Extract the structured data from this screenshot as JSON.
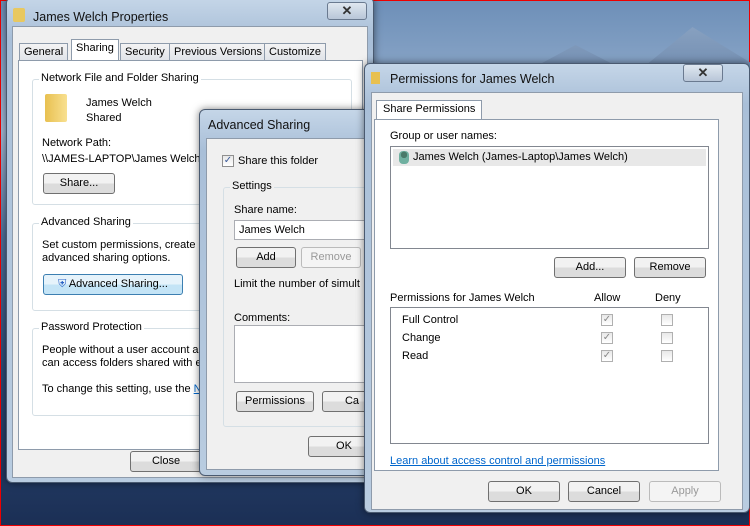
{
  "properties": {
    "title": "James Welch Properties",
    "tabs": [
      "General",
      "Sharing",
      "Security",
      "Previous Versions",
      "Customize"
    ],
    "network_group": "Network File and Folder Sharing",
    "folder_name": "James Welch",
    "folder_status": "Shared",
    "network_path_label": "Network Path:",
    "network_path": "\\\\JAMES-LAPTOP\\James Welch",
    "share_button": "Share...",
    "advanced_group": "Advanced Sharing",
    "advanced_text1": "Set custom permissions, create mu",
    "advanced_text2": "advanced sharing options.",
    "advanced_button": "Advanced Sharing...",
    "password_group": "Password Protection",
    "password_text1": "People without a user account an",
    "password_text2": "can access folders shared with ev",
    "password_text3": "To change this setting, use the ",
    "password_link": "Ne",
    "close_button": "Close"
  },
  "advanced": {
    "title": "Advanced Sharing",
    "share_checkbox": "Share this folder",
    "share_checked": true,
    "settings_group": "Settings",
    "share_name_label": "Share name:",
    "share_name_value": "James Welch",
    "add_button": "Add",
    "remove_button": "Remove",
    "limit_text": "Limit the number of simult",
    "comments_label": "Comments:",
    "permissions_button": "Permissions",
    "caching_button": "Ca",
    "ok_button": "OK"
  },
  "permissions": {
    "title": "Permissions for James Welch",
    "tab": "Share Permissions",
    "group_label": "Group or user names:",
    "users": [
      "James Welch (James-Laptop\\James Welch)"
    ],
    "add_button": "Add...",
    "remove_button": "Remove",
    "perm_header": "Permissions for James Welch",
    "allow_header": "Allow",
    "deny_header": "Deny",
    "rows": [
      {
        "name": "Full Control",
        "allow": true,
        "deny": false
      },
      {
        "name": "Change",
        "allow": true,
        "deny": false
      },
      {
        "name": "Read",
        "allow": true,
        "deny": false
      }
    ],
    "link": "Learn about access control and permissions",
    "ok_button": "OK",
    "cancel_button": "Cancel",
    "apply_button": "Apply"
  },
  "colors": {
    "link": "#0066cc",
    "selection": "#e8e8e8"
  }
}
